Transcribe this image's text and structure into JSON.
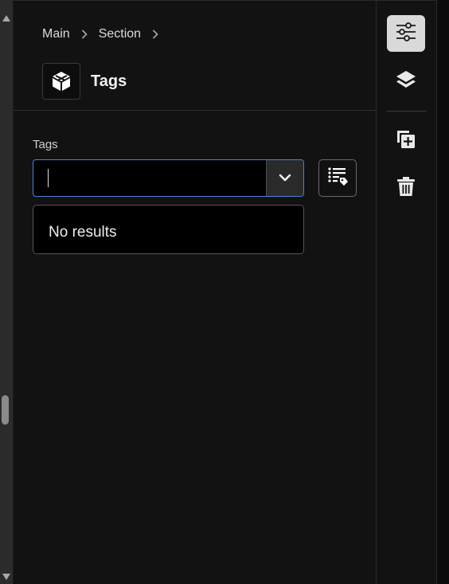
{
  "breadcrumb": {
    "items": [
      "Main",
      "Section"
    ]
  },
  "header": {
    "title": "Tags",
    "icon": "cube-icon"
  },
  "field": {
    "label": "Tags",
    "value": "",
    "placeholder": ""
  },
  "dropdown": {
    "message": "No results"
  },
  "toolbar": {
    "items": [
      {
        "name": "properties",
        "icon": "sliders-icon",
        "active": true
      },
      {
        "name": "layers",
        "icon": "layers-icon",
        "active": false
      },
      {
        "name": "add-item",
        "icon": "add-copy-icon",
        "active": false
      },
      {
        "name": "delete",
        "icon": "trash-icon",
        "active": false
      }
    ]
  },
  "colors": {
    "accent_border": "#4b83d9",
    "background": "#121212",
    "active_tool": "#d9d9d9"
  }
}
